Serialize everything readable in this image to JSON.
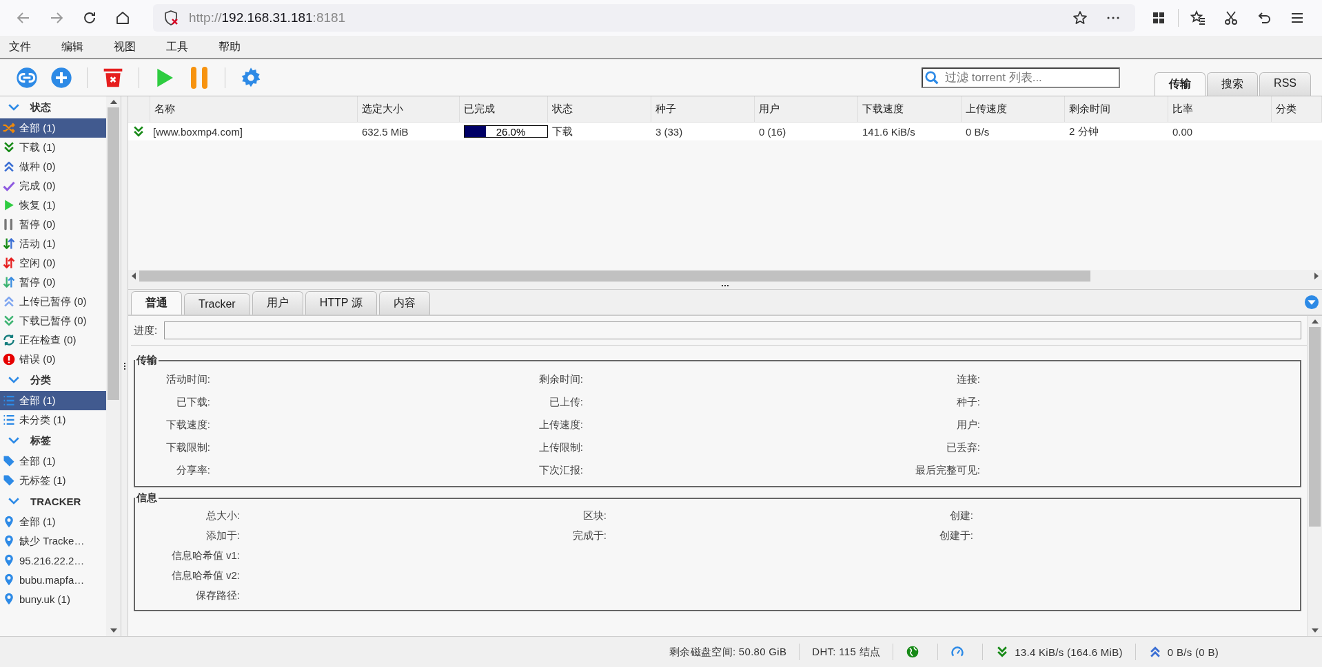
{
  "browser": {
    "url_scheme": "http://",
    "url_host": "192.168.31.181",
    "url_port": ":8181"
  },
  "menu": [
    "文件",
    "编辑",
    "视图",
    "工具",
    "帮助"
  ],
  "filter": {
    "placeholder": "过滤 torrent 列表..."
  },
  "top_tabs": [
    {
      "label": "传输",
      "selected": true
    },
    {
      "label": "搜索",
      "selected": false
    },
    {
      "label": "RSS",
      "selected": false
    }
  ],
  "sidebar": [
    {
      "title": "状态",
      "items": [
        {
          "label": "全部 (1)",
          "kind": "shuffle",
          "selected": true
        },
        {
          "label": "下载 (1)",
          "kind": "down",
          "selected": false
        },
        {
          "label": "做种 (0)",
          "kind": "up",
          "selected": false
        },
        {
          "label": "完成 (0)",
          "kind": "check",
          "selected": false
        },
        {
          "label": "恢复 (1)",
          "kind": "play",
          "selected": false
        },
        {
          "label": "暂停 (0)",
          "kind": "pause",
          "selected": false
        },
        {
          "label": "活动 (1)",
          "kind": "active",
          "selected": false
        },
        {
          "label": "空闲 (0)",
          "kind": "idle",
          "selected": false
        },
        {
          "label": "暂停 (0)",
          "kind": "stalled",
          "selected": false
        },
        {
          "label": "上传已暂停 (0)",
          "kind": "up_paused",
          "selected": false
        },
        {
          "label": "下载已暂停 (0)",
          "kind": "down_paused",
          "selected": false
        },
        {
          "label": "正在检查 (0)",
          "kind": "checking",
          "selected": false
        },
        {
          "label": "错误 (0)",
          "kind": "error",
          "selected": false
        }
      ]
    },
    {
      "title": "分类",
      "items": [
        {
          "label": "全部 (1)",
          "kind": "list",
          "selected": true
        },
        {
          "label": "未分类 (1)",
          "kind": "list",
          "selected": false
        }
      ]
    },
    {
      "title": "标签",
      "items": [
        {
          "label": "全部 (1)",
          "kind": "tag",
          "selected": false
        },
        {
          "label": "无标签 (1)",
          "kind": "tag",
          "selected": false
        }
      ]
    },
    {
      "title": "TRACKER",
      "items": [
        {
          "label": "全部 (1)",
          "kind": "pin",
          "selected": false
        },
        {
          "label": "缺少 Tracke…",
          "kind": "pin",
          "selected": false
        },
        {
          "label": "95.216.22.2…",
          "kind": "pin",
          "selected": false
        },
        {
          "label": "bubu.mapfa…",
          "kind": "pin",
          "selected": false
        },
        {
          "label": "buny.uk (1)",
          "kind": "pin",
          "selected": false
        }
      ]
    }
  ],
  "table": {
    "columns": [
      "名称",
      "选定大小",
      "已完成",
      "状态",
      "种子",
      "用户",
      "下载速度",
      "上传速度",
      "剩余时间",
      "比率",
      "分类"
    ],
    "rows": [
      {
        "kind": "down",
        "name": "[www.boxmp4.com]",
        "size": "632.5 MiB",
        "progress": {
          "level": 0.26,
          "text": "26.0%"
        },
        "state": "下载",
        "seeds": "3 (33)",
        "peers": "0 (16)",
        "down_speed": "141.6 KiB/s",
        "up_speed": "0 B/s",
        "eta": "2 分钟",
        "ratio": "0.00"
      }
    ]
  },
  "details": {
    "tabs": [
      {
        "label": "普通",
        "selected": true
      },
      {
        "label": "Tracker",
        "selected": false
      },
      {
        "label": "用户",
        "selected": false
      },
      {
        "label": "HTTP 源",
        "selected": false
      },
      {
        "label": "内容",
        "selected": false
      }
    ],
    "progress": {
      "label": "进度:",
      "level": 0
    },
    "transfer": {
      "title": "传输",
      "rows": [
        [
          "活动时间:",
          "剩余时间:",
          "连接:"
        ],
        [
          "已下载:",
          "已上传:",
          "种子:"
        ],
        [
          "下载速度:",
          "上传速度:",
          "用户:"
        ],
        [
          "下载限制:",
          "上传限制:",
          "已丢弃:"
        ],
        [
          "分享率:",
          "下次汇报:",
          "最后完整可见:"
        ]
      ]
    },
    "info": {
      "title": "信息",
      "rows": [
        [
          "总大小:",
          "区块:",
          "创建:"
        ],
        [
          "添加于:",
          "完成于:",
          "创建于:"
        ],
        [
          "信息哈希值 v1:"
        ],
        [
          "信息哈希值 v2:"
        ],
        [
          "保存路径:"
        ]
      ]
    }
  },
  "status_bar": {
    "free_space": "剩余磁盘空间: 50.80 GiB",
    "dht": "DHT: 115 结点",
    "download": "13.4 KiB/s (164.6 MiB)",
    "upload": "0 B/s (0 B)"
  }
}
